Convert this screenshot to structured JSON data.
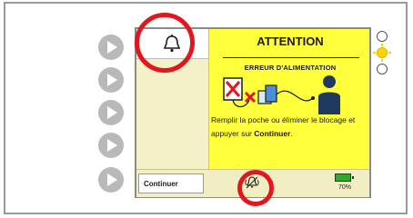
{
  "alarm": {
    "title": "ATTENTION",
    "subtitle": "ERREUR D'ALIMENTATION",
    "instruction_part1": "Remplir la poche ou éliminer le blocage et appuyer sur ",
    "instruction_bold": "Continuer",
    "instruction_end": "."
  },
  "bottom_bar": {
    "continue_label": "Continuer",
    "battery_level": "70%"
  },
  "icons": {
    "bell": "bell-icon",
    "mute": "silenced-bell-icon",
    "illustration": "feeding-error-illustration",
    "softkeys": "play-arrow-icon"
  },
  "colors": {
    "screen_background": "#ffff3c",
    "callout": "#e3161e",
    "battery_fill": "#2faa2f",
    "led_active": "#ffd400"
  },
  "status_leds": [
    {
      "state": "off"
    },
    {
      "state": "on",
      "color": "yellow"
    },
    {
      "state": "off"
    }
  ]
}
